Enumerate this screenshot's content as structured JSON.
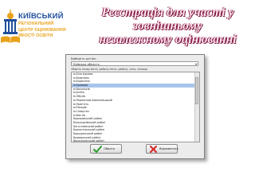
{
  "logo": {
    "title_lines": [
      "КИЇВСЬКИЙ"
    ],
    "sub_lines": [
      "РЕГІОНАЛЬНИЙ",
      "ЦЕНТР ОЦІНЮВАННЯ",
      "ЯКОСТІ ОСВІТИ"
    ],
    "icon": "building-book-icon"
  },
  "title": {
    "lines": [
      "Реєстрація для участі у",
      "зовнішньому",
      "незалежному оцінюванні"
    ]
  },
  "dialog": {
    "header": "Виберіть регіон",
    "select_value": "Київська область",
    "hint": "Оберіть назву міста, району міста, району, села, селища",
    "items": [
      "м.Біла Церква",
      "м.Березань",
      "м.Бориспіль",
      "м.Бровари",
      "м.Васильків",
      "м.Ірпінь",
      "м.Обухів",
      "м.Переяслав-Хмельницький",
      "м.Прип'ять",
      "м.Ржищів",
      "м.Славутич",
      "м.Фастів",
      "Баришівський район",
      "Білоцерківський район",
      "Богуславський район",
      "Бориспільський район",
      "Бородянський район",
      "Броварський район",
      "Васильківський район",
      "Вишгородський район",
      "Володарський район",
      "Згурівський район"
    ],
    "selected_index": 3,
    "ok_label": "Обрати",
    "cancel_label": "Відмовитись"
  },
  "colors": {
    "title_fill": "#fde7ef",
    "title_outline": "#8a1d4a",
    "logo_blue": "#1f4f9c",
    "logo_orange": "#e8a21a",
    "selection": "#a9c4ea"
  }
}
